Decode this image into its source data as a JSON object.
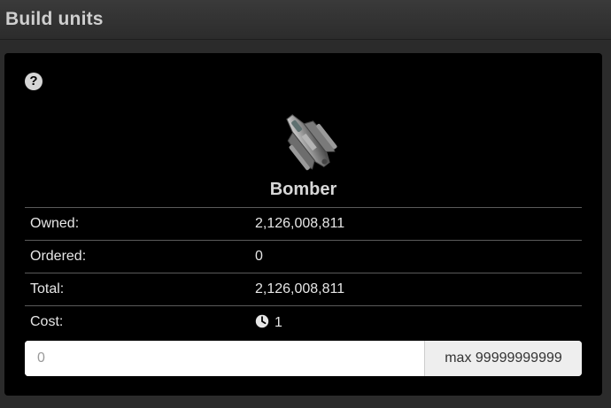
{
  "header": {
    "title": "Build units"
  },
  "help": {
    "icon": "question-circle-icon",
    "glyph": "?"
  },
  "unit": {
    "name": "Bomber",
    "image": "bomber-ship-image"
  },
  "stats": [
    {
      "label": "Owned:",
      "value": "2,126,008,811"
    },
    {
      "label": "Ordered:",
      "value": "0"
    },
    {
      "label": "Total:",
      "value": "2,126,008,811"
    },
    {
      "label": "Cost:",
      "value": "1",
      "icon": "clock-icon"
    }
  ],
  "quantity": {
    "placeholder": "0",
    "value": "",
    "max_label": "max 99999999999"
  }
}
